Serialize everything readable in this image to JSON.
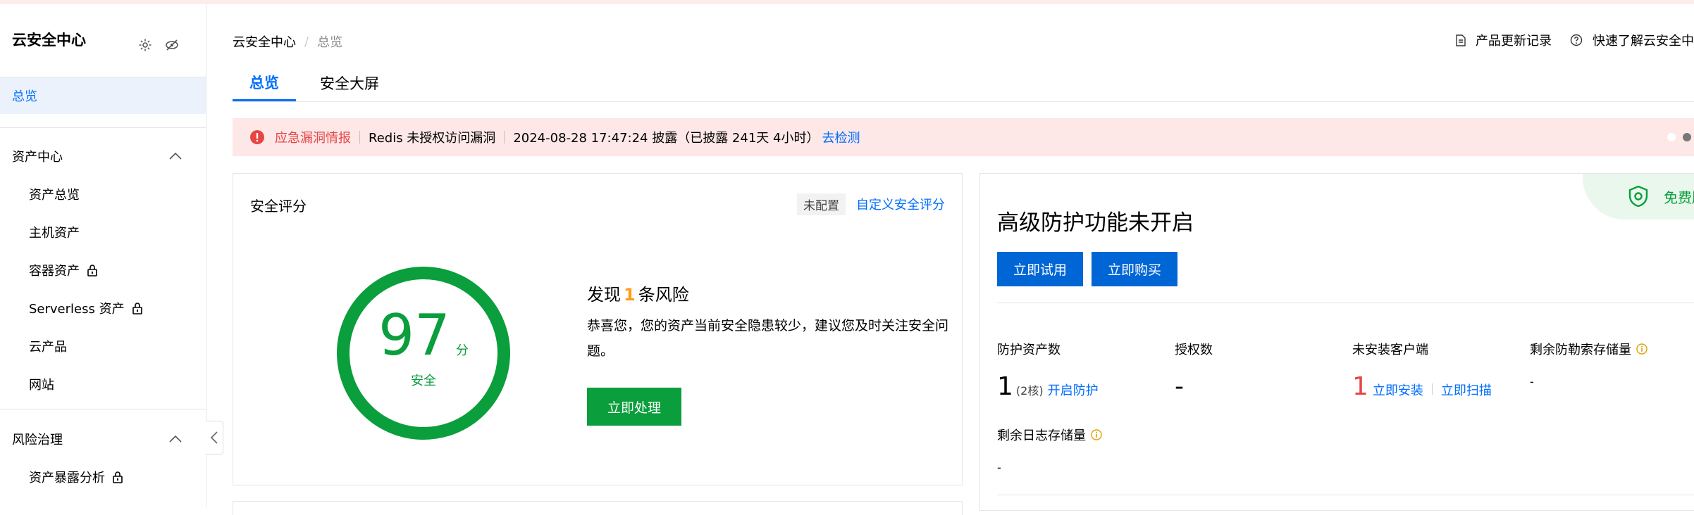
{
  "sidebar": {
    "title": "云安全中心",
    "items": [
      {
        "label": "总览",
        "active": true
      },
      {
        "label": "资产中心",
        "group": true
      },
      {
        "label": "资产总览"
      },
      {
        "label": "主机资产"
      },
      {
        "label": "容器资产",
        "locked": true
      },
      {
        "label": "Serverless 资产",
        "locked": true
      },
      {
        "label": "云产品"
      },
      {
        "label": "网站"
      },
      {
        "label": "风险治理",
        "group": true
      },
      {
        "label": "资产暴露分析",
        "locked": true
      }
    ]
  },
  "header": {
    "breadcrumb": [
      "云安全中心",
      "总览"
    ],
    "links": [
      "产品更新记录",
      "快速了解云安全中"
    ],
    "tabs": [
      "总览",
      "安全大屏"
    ]
  },
  "alert": {
    "tag": "应急漏洞情报",
    "vuln": "Redis 未授权访问漏洞",
    "time": "2024-08-28 17:47:24 披露（已披露 241天 4小时）",
    "link": "去检测"
  },
  "score_card": {
    "title": "安全评分",
    "status_badge": "未配置",
    "custom_link": "自定义安全评分",
    "score": "97",
    "score_unit": "分",
    "score_level": "安全",
    "risk_prefix": "发现",
    "risk_count": "1",
    "risk_suffix": "条风险",
    "risk_desc": "恭喜您，您的资产当前安全隐患较少，建议您及时关注安全问题。",
    "action_button": "立即处理"
  },
  "protect_card": {
    "title": "高级防护功能未开启",
    "edition": "免费版",
    "try_button": "立即试用",
    "buy_button": "立即购买",
    "stats": {
      "assets_label": "防护资产数",
      "assets_value": "1",
      "assets_cores": "(2核)",
      "assets_link": "开启防护",
      "license_label": "授权数",
      "license_value": "-",
      "clients_label": "未安装客户端",
      "clients_value": "1",
      "clients_install": "立即安装",
      "clients_scan": "立即扫描",
      "ransom_label": "剩余防勒索存储量",
      "ransom_value": "-",
      "log_label": "剩余日志存储量",
      "log_value": "-"
    }
  },
  "colors": {
    "accent": "#006eff",
    "success": "#0a9e3c",
    "danger": "#e54545",
    "warning": "#ff9c19"
  }
}
